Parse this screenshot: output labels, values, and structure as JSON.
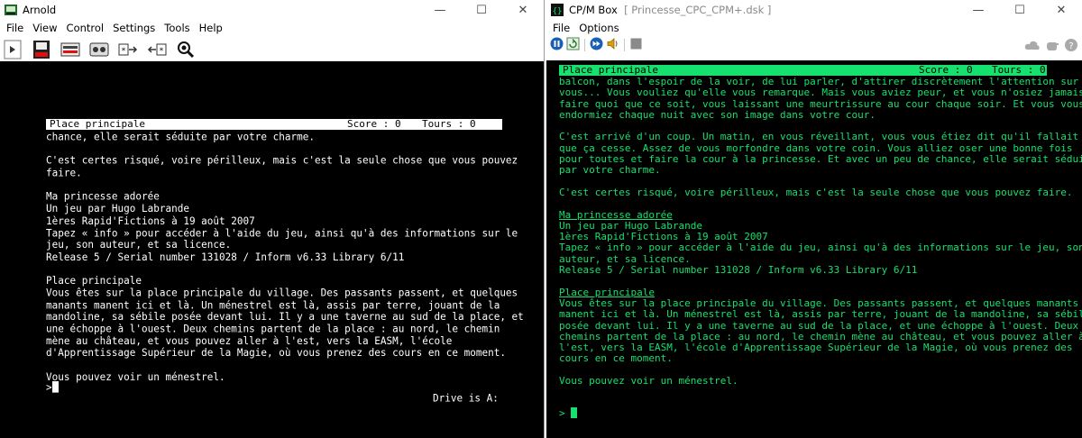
{
  "arnold": {
    "title": "Arnold",
    "window_controls": [
      "—",
      "☐",
      "✕"
    ],
    "menu": [
      "File",
      "View",
      "Control",
      "Settings",
      "Tools",
      "Help"
    ],
    "toolbar_icons": [
      "play-icon",
      "disk-drive-icon",
      "disk-drive-2-icon",
      "tape-icon",
      "snapshot-load-icon",
      "snapshot-save-icon",
      "debugger-icon"
    ],
    "screen": {
      "status": {
        "location": "Place principale",
        "score": "Score : 0",
        "turns": "Tours : 0"
      },
      "lines": [
        "chance, elle serait séduite par votre charme.",
        "",
        "C'est certes risqué, voire périlleux, mais c'est la seule chose que vous pouvez",
        "faire.",
        "",
        "Ma princesse adorée",
        "Un jeu par Hugo Labrande",
        "1ères Rapid'Fictions à 19 août 2007",
        "Tapez « info » pour accéder à l'aide du jeu, ainsi qu'à des informations sur le",
        "jeu, son auteur, et sa licence.",
        "Release 5 / Serial number 131028 / Inform v6.33 Library 6/11",
        "",
        "Place principale",
        "Vous êtes sur la place principale du village. Des passants passent, et quelques",
        "manants manent ici et là. Un ménestrel est là, assis par terre, jouant de la",
        "mandoline, sa sébile posée devant lui. Il y a une taverne au sud de la place, et",
        "une échoppe à l'ouest. Deux chemins partent de la place : au nord, le chemin",
        "mène au château, et vous pouvez aller à l'est, vers la EASM, l'école",
        "d'Apprentissage Supérieur de la Magie, où vous prenez des cours en ce moment.",
        "",
        "Vous pouvez voir un ménestrel.",
        ""
      ],
      "prompt": ">",
      "drive_status": "Drive is A:"
    }
  },
  "cpmbox": {
    "title": "CP/M Box",
    "subtitle": "[ Princesse_CPC_CPM+.dsk ]",
    "window_controls": [
      "—",
      "☐",
      "✕"
    ],
    "menu": [
      "File",
      "Options"
    ],
    "toolbar_icons": [
      "pause-icon",
      "reset-icon",
      "fast-forward-icon",
      "sound-icon",
      "stop-icon"
    ],
    "toolbar_right_icons": [
      "cloud-icon",
      "hand-icon",
      "help-icon"
    ],
    "screen": {
      "status": {
        "location": "Place principale",
        "score": "Score : 0",
        "turns": "Tours : 0"
      },
      "lines": [
        {
          "t": "balcon, dans l'espoir de la voir, de lui parler, d'attirer discrètement l'attention sur"
        },
        {
          "t": "vous... Vous vouliez qu'elle vous remarque. Mais vous aviez peur, et vous n'osiez jamais"
        },
        {
          "t": "faire quoi que ce soit, vous laissant une meurtrissure au cour chaque soir. Et vous vous"
        },
        {
          "t": "endormiez chaque nuit avec son image dans votre cour."
        },
        {
          "t": ""
        },
        {
          "t": "C'est arrivé d'un coup. Un matin, en vous réveillant, vous vous étiez dit qu'il fallait"
        },
        {
          "t": "que ça cesse. Assez de vous morfondre dans votre coin. Vous alliez oser une bonne fois"
        },
        {
          "t": "pour toutes et faire la cour à la princesse. Et avec un peu de chance, elle serait séduite"
        },
        {
          "t": "par votre charme."
        },
        {
          "t": ""
        },
        {
          "t": "C'est certes risqué, voire périlleux, mais c'est la seule chose que vous pouvez faire."
        },
        {
          "t": ""
        },
        {
          "t": "Ma princesse adorée",
          "u": true
        },
        {
          "t": "Un jeu par Hugo Labrande"
        },
        {
          "t": "1ères Rapid'Fictions à 19 août 2007"
        },
        {
          "t": "Tapez « info » pour accéder à l'aide du jeu, ainsi qu'à des informations sur le jeu, son"
        },
        {
          "t": "auteur, et sa licence."
        },
        {
          "t": "Release 5 / Serial number 131028 / Inform v6.33 Library 6/11"
        },
        {
          "t": ""
        },
        {
          "t": "Place principale",
          "u": true
        },
        {
          "t": "Vous êtes sur la place principale du village. Des passants passent, et quelques manants"
        },
        {
          "t": "manent ici et là. Un ménestrel est là, assis par terre, jouant de la mandoline, sa sébile"
        },
        {
          "t": "posée devant lui. Il y a une taverne au sud de la place, et une échoppe à l'ouest. Deux"
        },
        {
          "t": "chemins partent de la place : au nord, le chemin mène au château, et vous pouvez aller à"
        },
        {
          "t": "l'est, vers la EASM, l'école d'Apprentissage Supérieur de la Magie, où vous prenez des"
        },
        {
          "t": "cours en ce moment."
        },
        {
          "t": ""
        },
        {
          "t": "Vous pouvez voir un ménestrel."
        },
        {
          "t": ""
        }
      ],
      "prompt": ">"
    }
  },
  "colors": {
    "amstrad_text": "#ffffff",
    "cpm_green": "#16e06e",
    "screen_bg": "#000000"
  }
}
